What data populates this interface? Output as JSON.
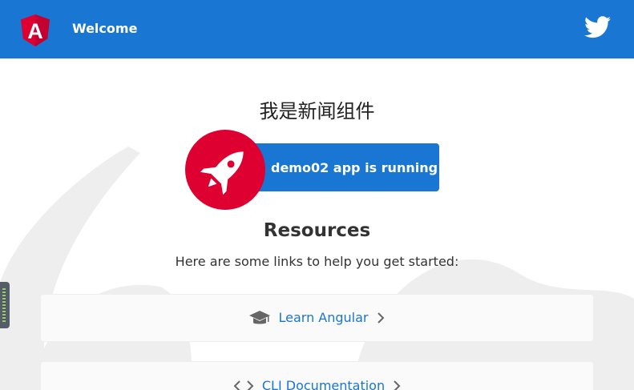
{
  "toolbar": {
    "logo_letter": "A",
    "title": "Welcome",
    "color": "#1976d2"
  },
  "main": {
    "heading": "我是新闻组件",
    "running_card": {
      "text": "demo02 app is running!",
      "icon": "rocket-icon",
      "accent": "#dd0031"
    },
    "resources": {
      "title": "Resources",
      "subtitle": "Here are some links to help you get started:",
      "links": [
        {
          "label": "Learn Angular",
          "icon": "graduation-cap-icon"
        },
        {
          "label": "CLI Documentation",
          "icon": "code-icon"
        }
      ]
    }
  }
}
